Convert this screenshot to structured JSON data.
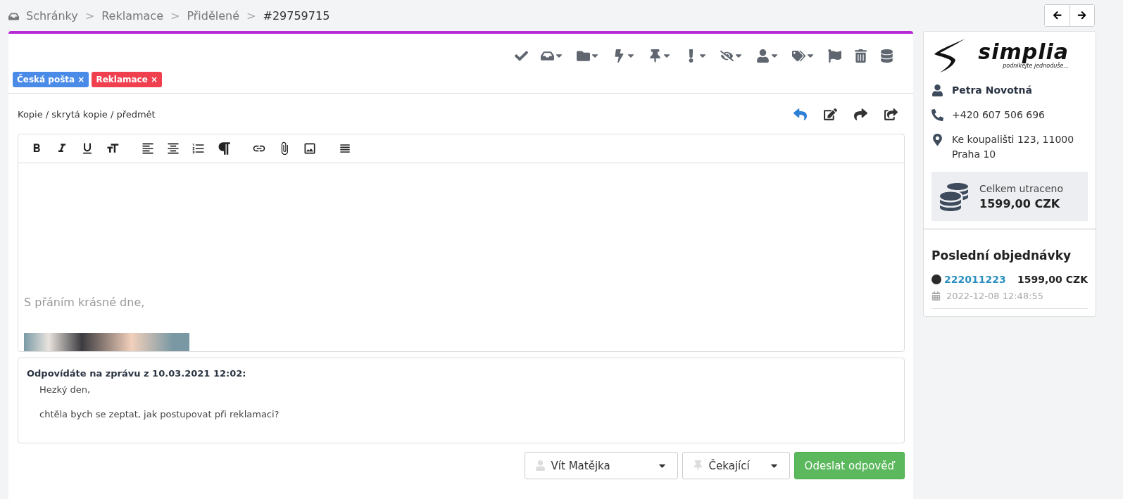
{
  "breadcrumb": [
    "Schránky",
    "Reklamace",
    "Přidělené",
    "#29759715"
  ],
  "breadcrumb_separator": ">",
  "tags": [
    {
      "label": "Česká pošta",
      "remove": "×",
      "color": "#4a8be8"
    },
    {
      "label": "Reklamace",
      "remove": "×",
      "color": "#f0404f"
    }
  ],
  "recipients_link": "Kopie / skrytá kopie / předmět",
  "reply_actions": [
    {
      "kind": "reply",
      "selected": true
    },
    {
      "kind": "edit",
      "selected": false
    },
    {
      "kind": "forward",
      "selected": false
    },
    {
      "kind": "share",
      "selected": false
    }
  ],
  "editor": {
    "signature": "S přáním krásné dne,"
  },
  "quote": {
    "heading": "Odpovídáte na zprávu z 10.03.2021 12:02:",
    "lines": [
      "Hezký den,",
      "chtěla bych se zeptat, jak postupovat při reklamaci?"
    ]
  },
  "footer": {
    "assignee": "Vít Matějka",
    "status": "Čekající",
    "send": "Odeslat odpověď"
  },
  "customer": {
    "logo": "simplia",
    "tagline": "podnikejte jednoduše...",
    "name": "Petra Novotná",
    "phone": "+420 607 506 696",
    "address": "Ke koupališti 123, 11000 Praha 10",
    "spent_label": "Celkem utraceno",
    "spent": "1599,00 CZK"
  },
  "orders": {
    "title": "Poslední objednávky",
    "items": [
      {
        "number": "222011223",
        "total": "1599,00 CZK",
        "date": "2022-12-08 12:48:55",
        "color": "#2b2b2b"
      }
    ]
  }
}
